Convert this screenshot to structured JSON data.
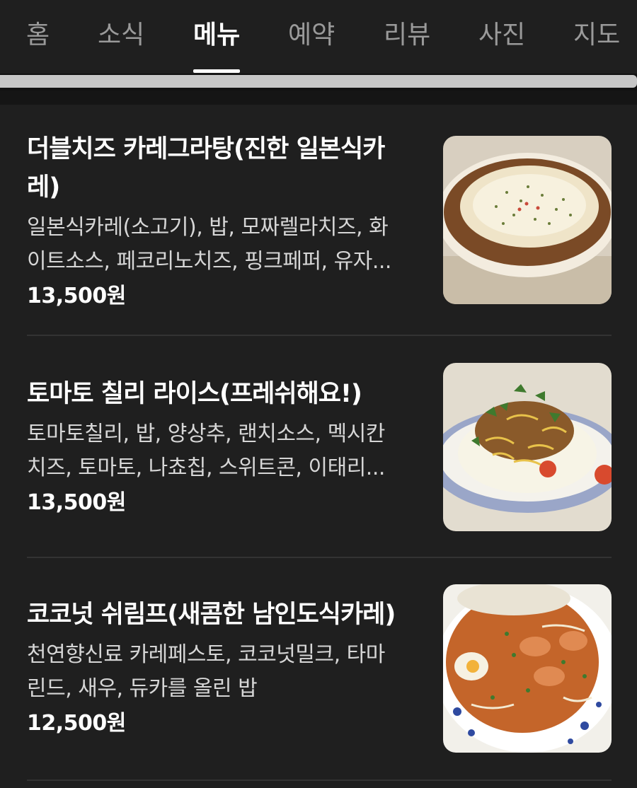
{
  "tabs": [
    {
      "label": "홈",
      "active": false
    },
    {
      "label": "소식",
      "active": false
    },
    {
      "label": "메뉴",
      "active": true
    },
    {
      "label": "예약",
      "active": false
    },
    {
      "label": "리뷰",
      "active": false
    },
    {
      "label": "사진",
      "active": false
    },
    {
      "label": "지도",
      "active": false
    }
  ],
  "menu_items": [
    {
      "name_line1": "더블치즈 카레그라탕(진한 일본식카",
      "name_line2": "레)",
      "desc_line1": "일본식카레(소고기), 밥, 모짜렐라치즈, 화",
      "desc_line2": "이트소스, 페코리노치즈, 핑크페퍼, 유자...",
      "price": "13,500원",
      "image": "cheese-gratin-curry-photo"
    },
    {
      "name_line1": "토마토 칠리 라이스(프레쉬해요!)",
      "desc_line1": "토마토칠리, 밥, 양상추, 랜치소스, 멕시칸",
      "desc_line2": "치즈, 토마토, 나쵸칩, 스위트콘, 이태리...",
      "price": "13,500원",
      "image": "tomato-chili-rice-photo"
    },
    {
      "name_line1": "코코넛 쉬림프(새콤한 남인도식카레)",
      "desc_line1": "천연향신료 카레페스토, 코코넛밀크, 타마",
      "desc_line2": "린드, 새우, 듀카를 올린 밥",
      "price": "12,500원",
      "image": "coconut-shrimp-curry-photo"
    }
  ],
  "colors": {
    "background": "#1f1f1f",
    "text": "#ffffff",
    "muted": "#9a9a9a",
    "divider": "#333333"
  }
}
